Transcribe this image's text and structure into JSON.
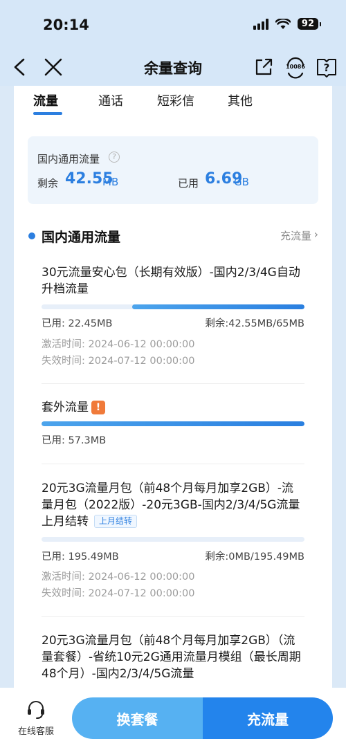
{
  "status_bar": {
    "time": "20:14",
    "battery": "92"
  },
  "nav": {
    "title": "余量查询",
    "hotline": "10086"
  },
  "tabs": [
    {
      "label": "流量",
      "active": true
    },
    {
      "label": "通话",
      "active": false
    },
    {
      "label": "短彩信",
      "active": false
    },
    {
      "label": "其他",
      "active": false
    }
  ],
  "summary": {
    "title": "国内通用流量",
    "remaining_label": "剩余",
    "remaining_value": "42.55",
    "remaining_unit": "MB",
    "used_label": "已用",
    "used_value": "6.69",
    "used_unit": "GB"
  },
  "section": {
    "title": "国内通用流量",
    "topup_link": "充流量"
  },
  "packages": [
    {
      "name": "30元流量安心包（长期有效版）-国内2/3/4G自动升档流量",
      "used": "已用: 22.45MB",
      "remaining": "剩余:42.55MB/65MB",
      "remaining_fraction": 0.6546,
      "activated": "激活时间: 2024-06-12 00:00:00",
      "expires": "失效时间: 2024-07-12 00:00:00"
    },
    {
      "name": "套外流量",
      "used": "已用: 57.3MB",
      "remaining_fraction": 1.0
    },
    {
      "name": "20元3G流量月包（前48个月每月加享2GB）-流量月包（2022版）-20元3GB-国内2/3/4/5G流量上月结转",
      "badge": "上月结转",
      "used": "已用: 195.49MB",
      "remaining": "剩余:0MB/195.49MB",
      "remaining_fraction": 0.0,
      "activated": "激活时间: 2024-06-12 00:00:00",
      "expires": "失效时间: 2024-07-12 00:00:00"
    },
    {
      "name": "20元3G流量月包（前48个月每月加享2GB）（流量套餐）-省统10元2G通用流量月模组（最长周期48个月）-国内2/3/4/5G流量"
    }
  ],
  "bottom": {
    "customer_service": "在线客服",
    "change_plan": "换套餐",
    "topup": "充流量"
  },
  "colors": {
    "accent": "#2c7fe0",
    "header_bg": "#d6e7f8",
    "warning": "#f07a3a"
  }
}
